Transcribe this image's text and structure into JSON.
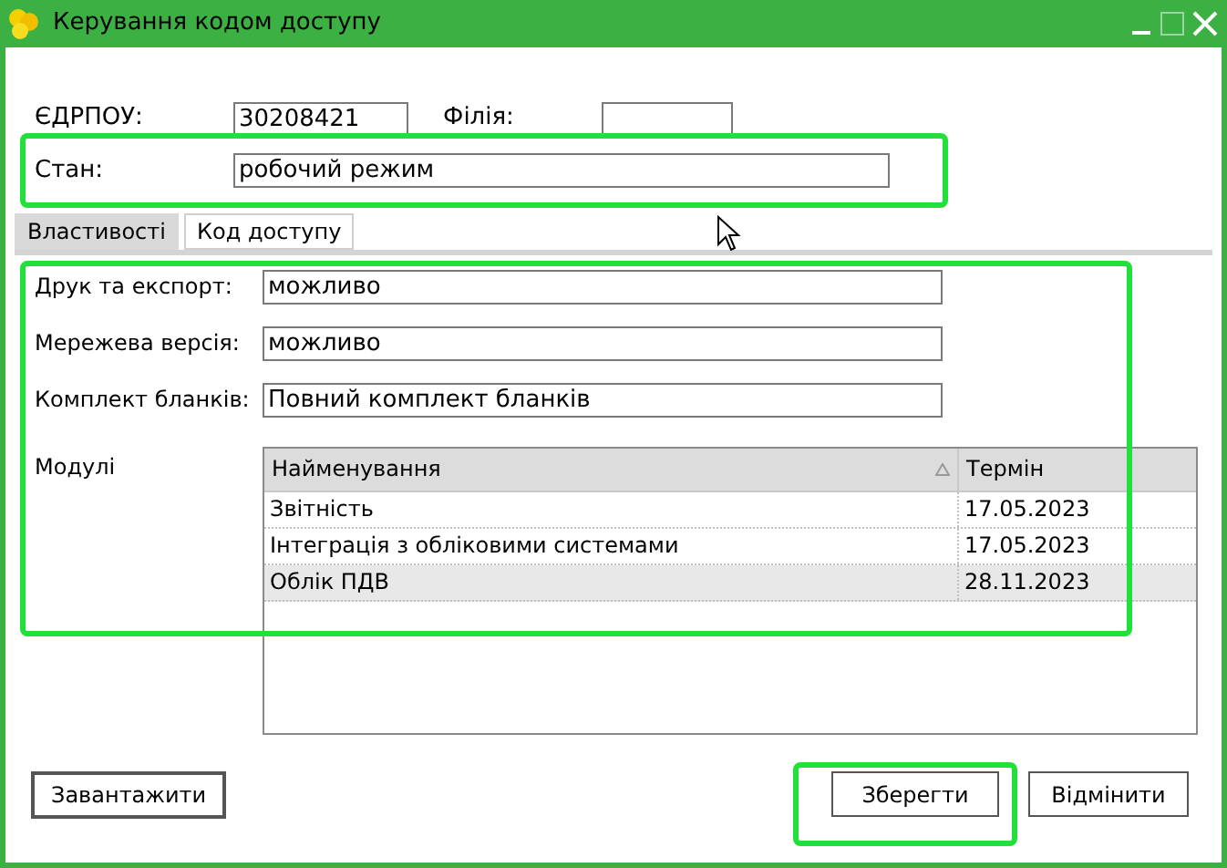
{
  "window": {
    "title": "Керування кодом доступу"
  },
  "header_fields": [
    {
      "label": "ЄДРПОУ:",
      "value": "30208421"
    },
    {
      "label": "Філія:"
    }
  ],
  "state_field": {
    "label": "Стан:",
    "value": "робочий режим"
  },
  "tabs": [
    {
      "label": "Властивості",
      "selected": true
    },
    {
      "label": "Код доступу",
      "selected": false
    }
  ],
  "properties": [
    {
      "label": "Друк та експорт:",
      "value": "можливо"
    },
    {
      "label": "Мережева версія:",
      "value": "можливо"
    },
    {
      "label": "Комплект бланків:",
      "value": "Повний комплект бланків"
    }
  ],
  "modules": {
    "label": "Модулі",
    "columns": [
      "Найменування",
      "Термін"
    ],
    "rows": [
      {
        "name": "Звітність",
        "term": "17.05.2023",
        "selected": false
      },
      {
        "name": "Інтеграція з обліковими системами",
        "term": "17.05.2023",
        "selected": false
      },
      {
        "name": "Облік ПДВ",
        "term": "28.11.2023",
        "selected": true
      }
    ]
  },
  "buttons": {
    "load": "Завантажити",
    "save": "Зберегти",
    "cancel": "Відмінити"
  }
}
